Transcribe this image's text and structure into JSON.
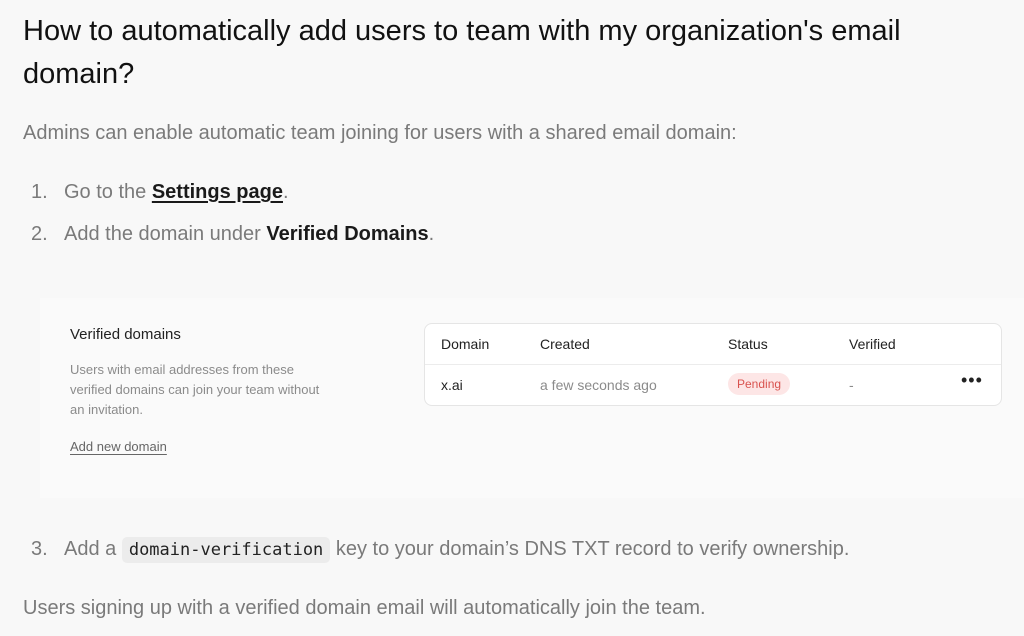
{
  "title": "How to automatically add users to team with my organization's email domain?",
  "intro": "Admins can enable automatic team joining for users with a shared email domain:",
  "steps": [
    {
      "num": "1.",
      "pre": "Go to the ",
      "link": "Settings page",
      "post": "."
    },
    {
      "num": "2.",
      "pre": "Add the domain under ",
      "bold": "Verified Domains",
      "post": "."
    },
    {
      "num": "3.",
      "pre": "Add a ",
      "code": "domain-verification",
      "post": " key to your domain’s DNS TXT record to verify ownership."
    }
  ],
  "panel": {
    "title": "Verified domains",
    "description": "Users with email addresses from these verified domains can join your team without an invitation.",
    "add_link": "Add new domain",
    "table": {
      "headers": [
        "Domain",
        "Created",
        "Status",
        "Verified"
      ],
      "rows": [
        {
          "domain": "x.ai",
          "created": "a few seconds ago",
          "status": "Pending",
          "verified": "-",
          "actions": "•••"
        }
      ]
    }
  },
  "outro": "Users signing up with a verified domain email will automatically join the team.",
  "colors": {
    "pending_bg": "#fde6e6",
    "pending_fg": "#d9534f",
    "muted_text": "#7a7a7a"
  }
}
